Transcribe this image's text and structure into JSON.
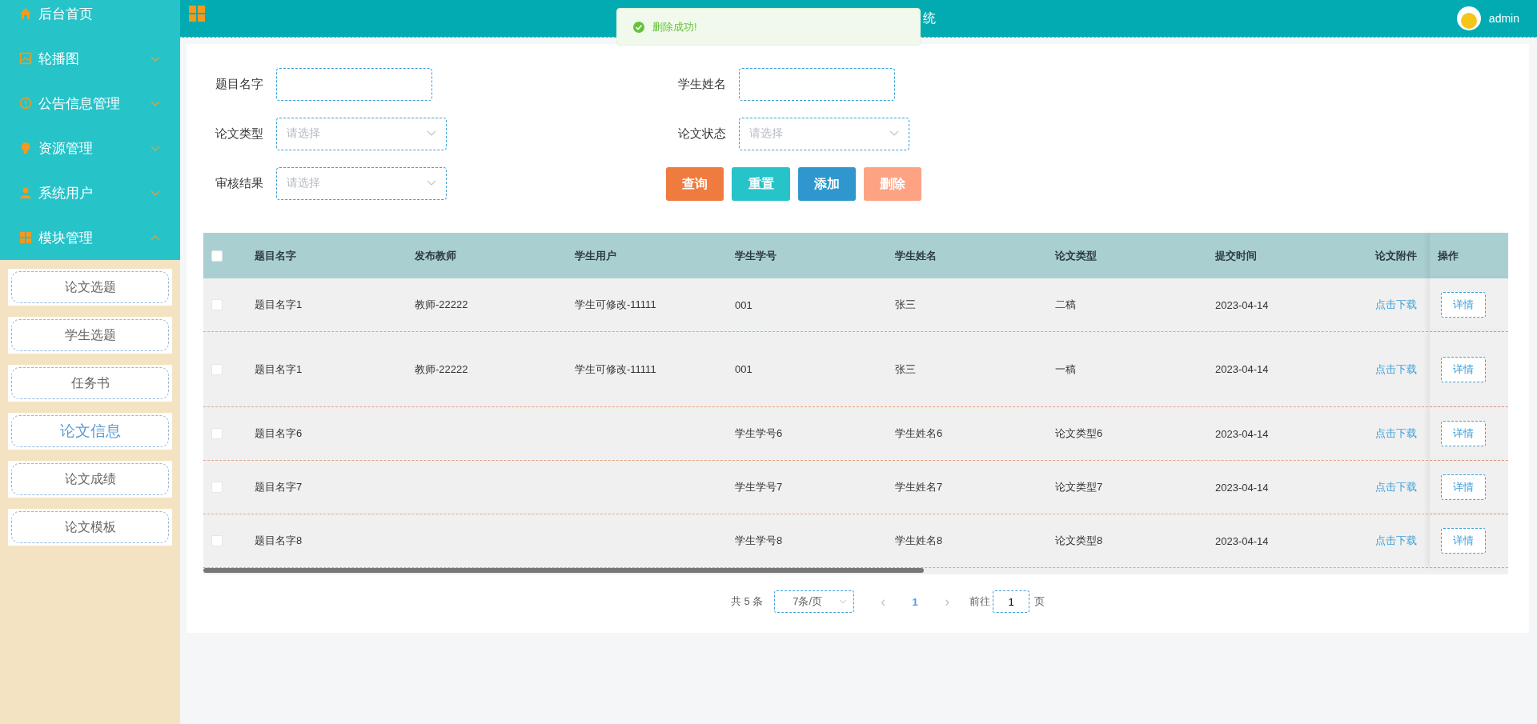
{
  "sidebar": {
    "menus": [
      {
        "label": "后台首页",
        "kind": "link"
      },
      {
        "label": "轮播图",
        "kind": "group",
        "expanded": false
      },
      {
        "label": "公告信息管理",
        "kind": "group",
        "expanded": false
      },
      {
        "label": "资源管理",
        "kind": "group",
        "expanded": false
      },
      {
        "label": "系统用户",
        "kind": "group",
        "expanded": false
      },
      {
        "label": "模块管理",
        "kind": "group",
        "expanded": true,
        "children": [
          {
            "label": "论文选题",
            "selected": false
          },
          {
            "label": "学生选题",
            "selected": false
          },
          {
            "label": "任务书",
            "selected": false
          },
          {
            "label": "论文信息",
            "selected": true
          },
          {
            "label": "论文成绩",
            "selected": false
          },
          {
            "label": "论文模板",
            "selected": false
          }
        ]
      }
    ]
  },
  "header": {
    "title": "统",
    "user": "admin"
  },
  "toast": {
    "message": "删除成功!"
  },
  "search_form": {
    "fields": [
      {
        "label": "题目名字",
        "kind": "input"
      },
      {
        "label": "学生姓名",
        "kind": "input"
      },
      {
        "label": "论文类型",
        "kind": "select",
        "placeholder": "请选择"
      },
      {
        "label": "论文状态",
        "kind": "select",
        "placeholder": "请选择"
      },
      {
        "label": "审核结果",
        "kind": "select",
        "placeholder": "请选择"
      }
    ],
    "buttons": [
      {
        "label": "查询",
        "kind": "query"
      },
      {
        "label": "重置",
        "kind": "reset"
      },
      {
        "label": "添加",
        "kind": "add"
      },
      {
        "label": "删除",
        "kind": "delete"
      }
    ]
  },
  "table": {
    "select_all_checked": false,
    "columns": [
      "题目名字",
      "发布教师",
      "学生用户",
      "学生学号",
      "学生姓名",
      "论文类型",
      "提交时间",
      "论文附件",
      "操作"
    ],
    "rows": [
      {
        "checked": false,
        "cells": [
          "题目名字1",
          "教师-22222",
          "学生可修改-11111",
          "001",
          "张三",
          "二稿",
          "2023-04-14"
        ],
        "attachment": "点击下载",
        "action": "详情"
      },
      {
        "checked": false,
        "cells": [
          "题目名字1",
          "教师-22222",
          "学生可修改-11111",
          "001",
          "张三",
          "一稿",
          "2023-04-14"
        ],
        "attachment": "点击下载",
        "action": "详情"
      },
      {
        "checked": false,
        "cells": [
          "题目名字6",
          "",
          "",
          "学生学号6",
          "学生姓名6",
          "论文类型6",
          "2023-04-14"
        ],
        "attachment": "点击下载",
        "action": "详情"
      },
      {
        "checked": false,
        "cells": [
          "题目名字7",
          "",
          "",
          "学生学号7",
          "学生姓名7",
          "论文类型7",
          "2023-04-14"
        ],
        "attachment": "点击下载",
        "action": "详情"
      },
      {
        "checked": false,
        "cells": [
          "题目名字8",
          "",
          "",
          "学生学号8",
          "学生姓名8",
          "论文类型8",
          "2023-04-14"
        ],
        "attachment": "点击下载",
        "action": "详情"
      }
    ]
  },
  "pagination": {
    "total": "共 5 条",
    "page_size": "7条/页",
    "prev": "‹",
    "current_page": "1",
    "next": "›",
    "goto_label": "前往",
    "goto_value": "1",
    "goto_suffix": "页"
  }
}
